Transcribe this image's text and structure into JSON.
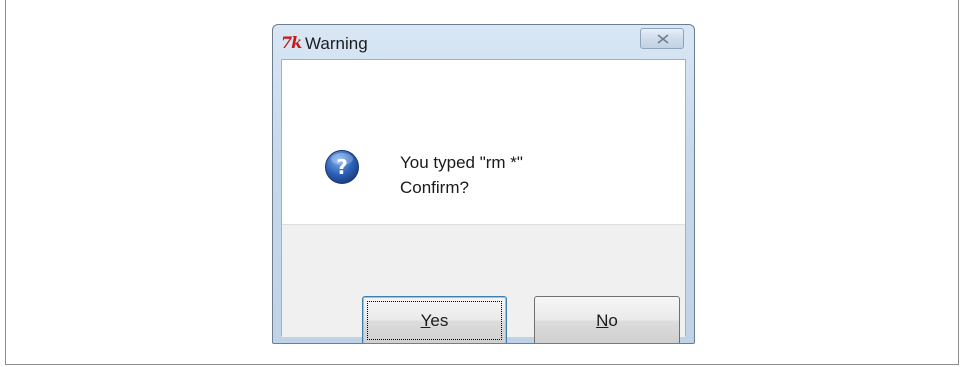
{
  "window": {
    "title": "Warning",
    "app_icon": "tk-icon",
    "close_icon": "close-icon"
  },
  "message": {
    "icon": "question-icon",
    "line1": "You typed \"rm *\"",
    "line2": "Confirm?"
  },
  "buttons": {
    "yes": {
      "mnemonic": "Y",
      "rest": "es"
    },
    "no": {
      "mnemonic": "N",
      "rest": "o"
    }
  },
  "colors": {
    "title_bar": "#c7d9ec",
    "tk_logo": "#c61a1a",
    "question_icon": "#2c62b8"
  }
}
